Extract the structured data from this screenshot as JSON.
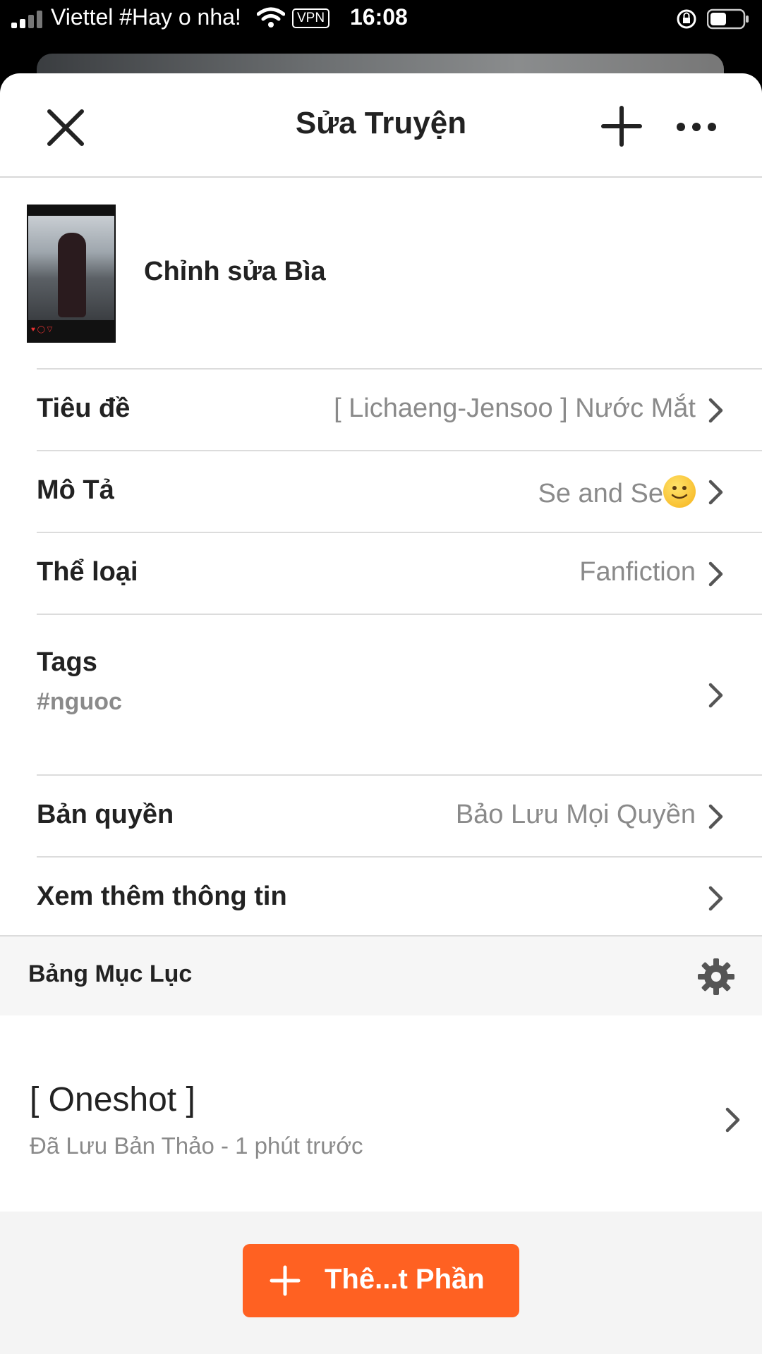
{
  "status_bar": {
    "carrier": "Viettel #Hay o nha!",
    "vpn": "VPN",
    "time": "16:08"
  },
  "header": {
    "title": "Sửa Truyện"
  },
  "cover": {
    "label": "Chỉnh sửa Bìa"
  },
  "details": [
    {
      "label": "Tiêu đề",
      "value": "[ Lichaeng-Jensoo ] Nước Mắt"
    },
    {
      "label": "Mô Tả",
      "value": "Se and Se",
      "emoji": "slightly-smiling-face-emoji"
    },
    {
      "label": "Thể loại",
      "value": "Fanfiction"
    },
    {
      "label": "Tags",
      "value": "#nguoc"
    },
    {
      "label": "Bản quyền",
      "value": "Bảo Lưu Mọi Quyền"
    },
    {
      "label": "Xem thêm thông tin",
      "value": ""
    }
  ],
  "toc": {
    "label": "Bảng Mục Lục"
  },
  "parts": [
    {
      "title": "[ Oneshot ]",
      "status": "Đã Lưu Bản Thảo - 1 phút trước"
    }
  ],
  "add_part_button": {
    "label": "Thê...t Phần"
  },
  "colors": {
    "accent": "#ff6122",
    "muted_text": "#8a8a8a",
    "divider": "#dcdcdc"
  }
}
